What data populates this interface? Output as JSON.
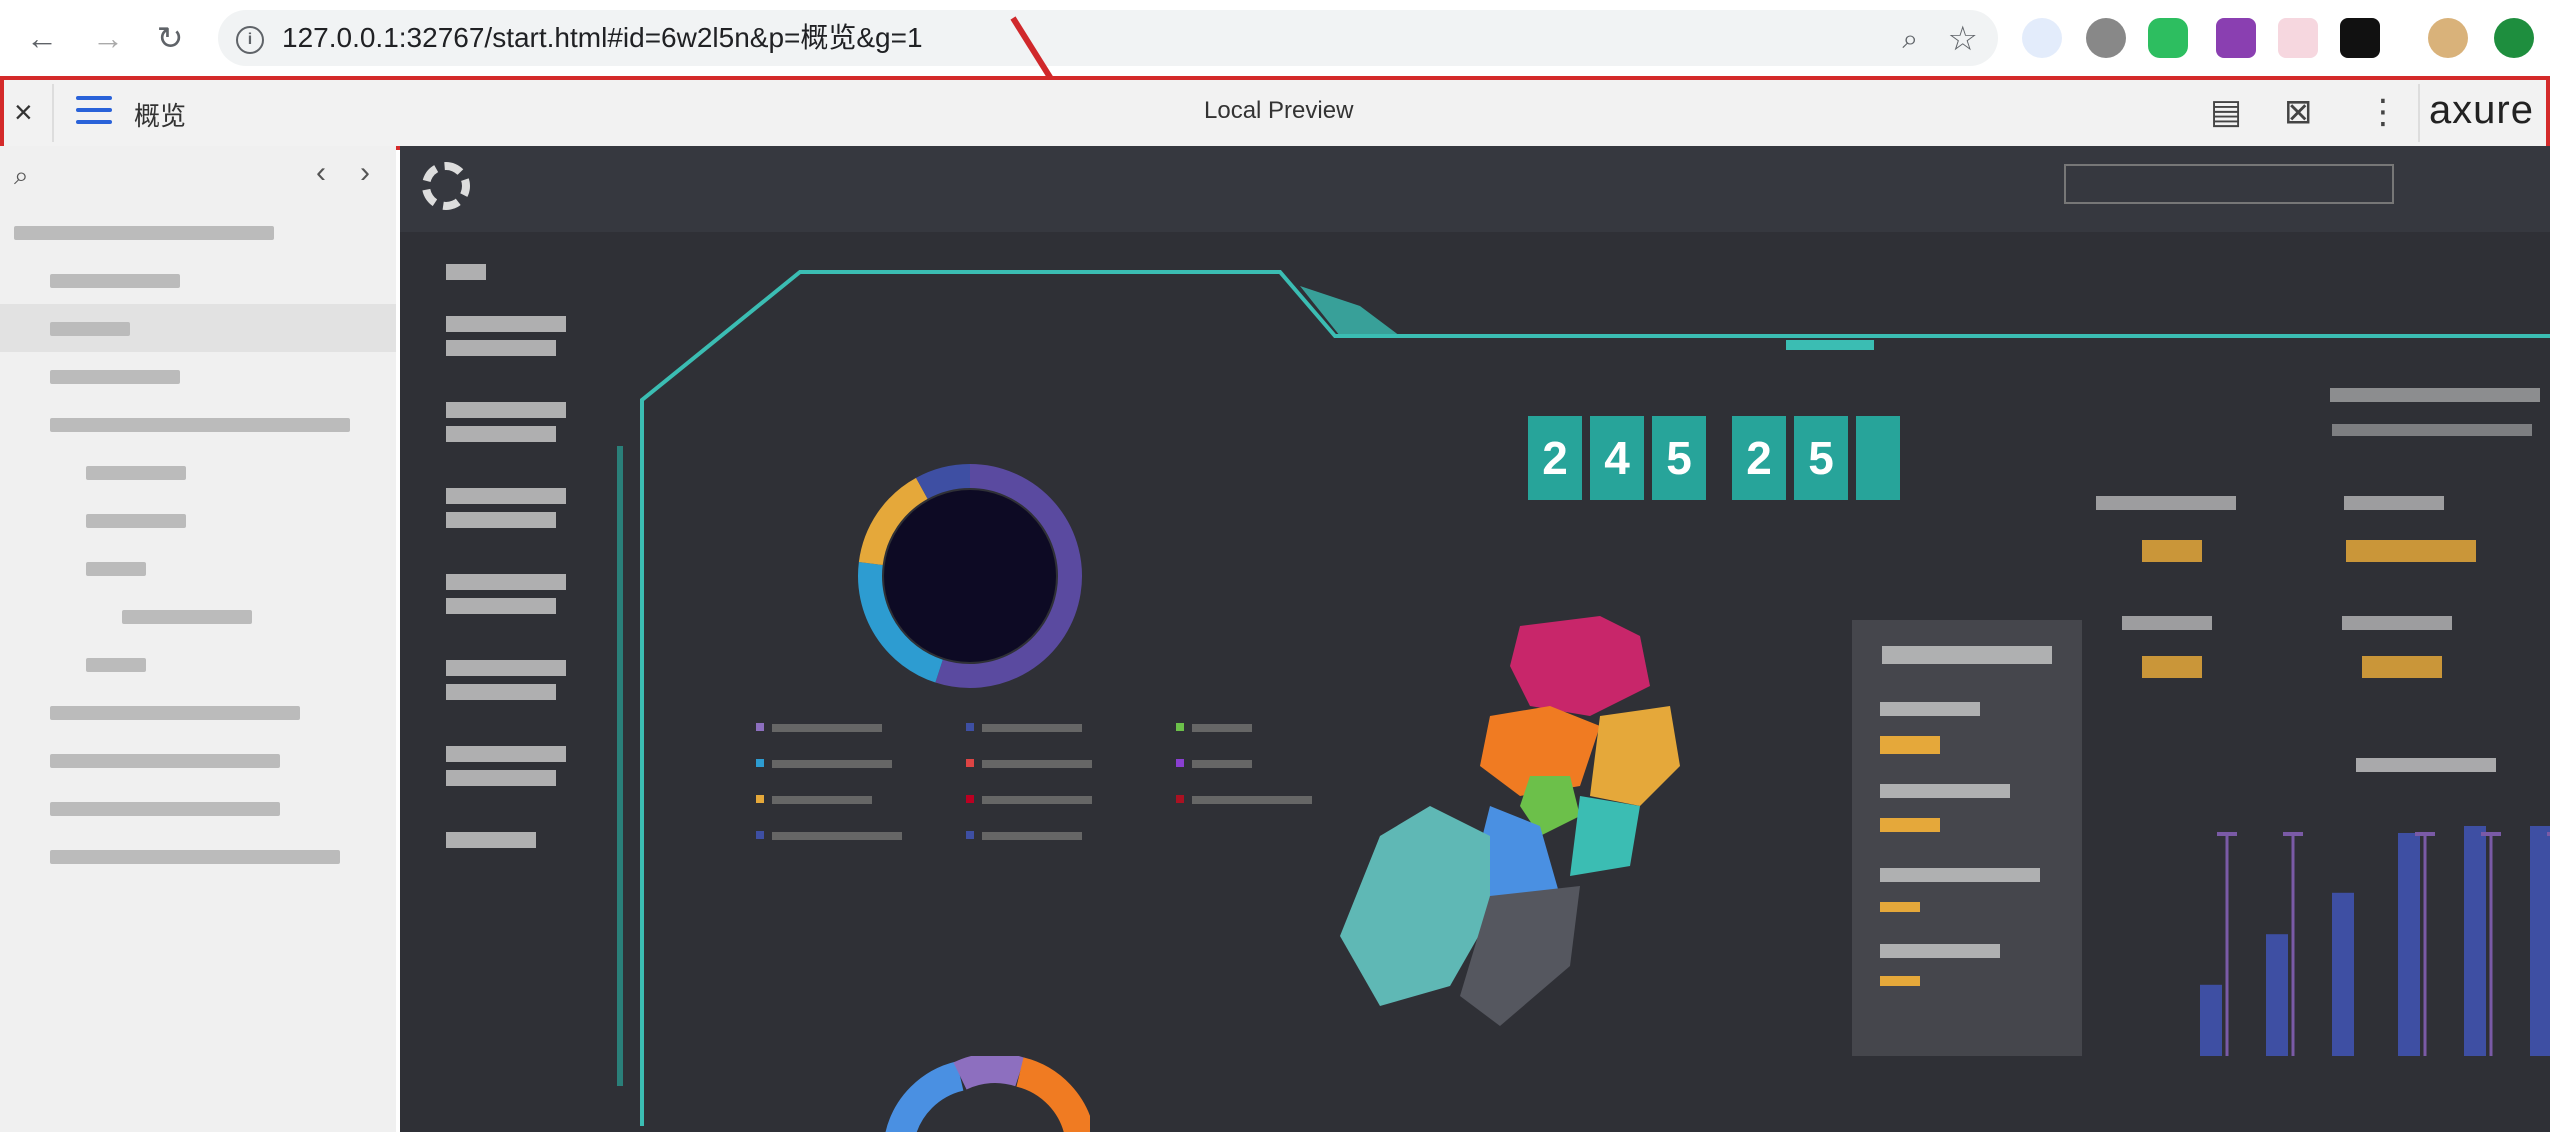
{
  "browser": {
    "url": "127.0.0.1:32767/start.html#id=6w2l5n&p=概览&g=1"
  },
  "axure_toolbar": {
    "page_name": "概览",
    "title": "Local Preview",
    "logo": "axure"
  },
  "sidebar": {
    "items": [
      {
        "label": "",
        "indent": 0,
        "width": 260
      },
      {
        "label": "",
        "indent": 1,
        "width": 130
      },
      {
        "label": "",
        "indent": 1,
        "width": 80,
        "selected": true
      },
      {
        "label": "",
        "indent": 1,
        "width": 130
      },
      {
        "label": "",
        "indent": 1,
        "width": 300
      },
      {
        "label": "",
        "indent": 2,
        "width": 100
      },
      {
        "label": "",
        "indent": 2,
        "width": 100
      },
      {
        "label": "",
        "indent": 2,
        "width": 60
      },
      {
        "label": "",
        "indent": 3,
        "width": 130
      },
      {
        "label": "",
        "indent": 2,
        "width": 60
      },
      {
        "label": "",
        "indent": 1,
        "width": 250
      },
      {
        "label": "",
        "indent": 1,
        "width": 230
      },
      {
        "label": "",
        "indent": 1,
        "width": 230
      },
      {
        "label": "",
        "indent": 1,
        "width": 290
      }
    ]
  },
  "dashboard": {
    "app_title": "",
    "select_text": "",
    "main_title": "",
    "left_nav": [
      "",
      "",
      "",
      "",
      "",
      "",
      "",
      ""
    ],
    "digits": [
      "2",
      "4",
      "5",
      "2",
      "5"
    ],
    "colors": {
      "accent": "#3bbdb3",
      "digit_bg": "#27a49a",
      "highlight": "#e5a83a",
      "bar": "#3e4fa3",
      "bar_line": "#7a5aa6"
    },
    "donut_segments": [
      0.55,
      0.22,
      0.15,
      0.08
    ]
  }
}
